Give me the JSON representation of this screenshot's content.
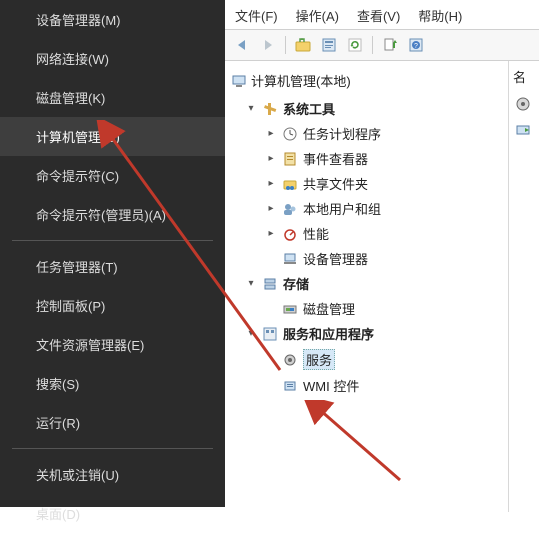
{
  "context_menu": {
    "items": [
      {
        "label": "设备管理器(M)"
      },
      {
        "label": "网络连接(W)"
      },
      {
        "label": "磁盘管理(K)"
      },
      {
        "label": "计算机管理(G)",
        "highlight": true
      },
      {
        "label": "命令提示符(C)"
      },
      {
        "label": "命令提示符(管理员)(A)"
      }
    ],
    "items2": [
      {
        "label": "任务管理器(T)"
      },
      {
        "label": "控制面板(P)"
      },
      {
        "label": "文件资源管理器(E)"
      },
      {
        "label": "搜索(S)"
      },
      {
        "label": "运行(R)"
      }
    ],
    "items3": [
      {
        "label": "关机或注销(U)"
      },
      {
        "label": "桌面(D)"
      }
    ]
  },
  "menubar": {
    "file": "文件(F)",
    "action": "操作(A)",
    "view": "查看(V)",
    "help": "帮助(H)"
  },
  "toolbar": {
    "back_icon": "back-icon",
    "fwd_icon": "forward-icon",
    "up_icon": "up-icon",
    "props_icon": "properties-icon",
    "refresh_icon": "refresh-icon",
    "export_icon": "export-icon",
    "help_icon": "help-icon"
  },
  "tree": {
    "root": "计算机管理(本地)",
    "group_tools": "系统工具",
    "task_scheduler": "任务计划程序",
    "event_viewer": "事件查看器",
    "shared_folders": "共享文件夹",
    "local_users": "本地用户和组",
    "performance": "性能",
    "device_manager": "设备管理器",
    "storage": "存储",
    "disk_mgmt": "磁盘管理",
    "services_apps": "服务和应用程序",
    "services": "服务",
    "wmi": "WMI 控件"
  },
  "side": {
    "header": "名"
  }
}
